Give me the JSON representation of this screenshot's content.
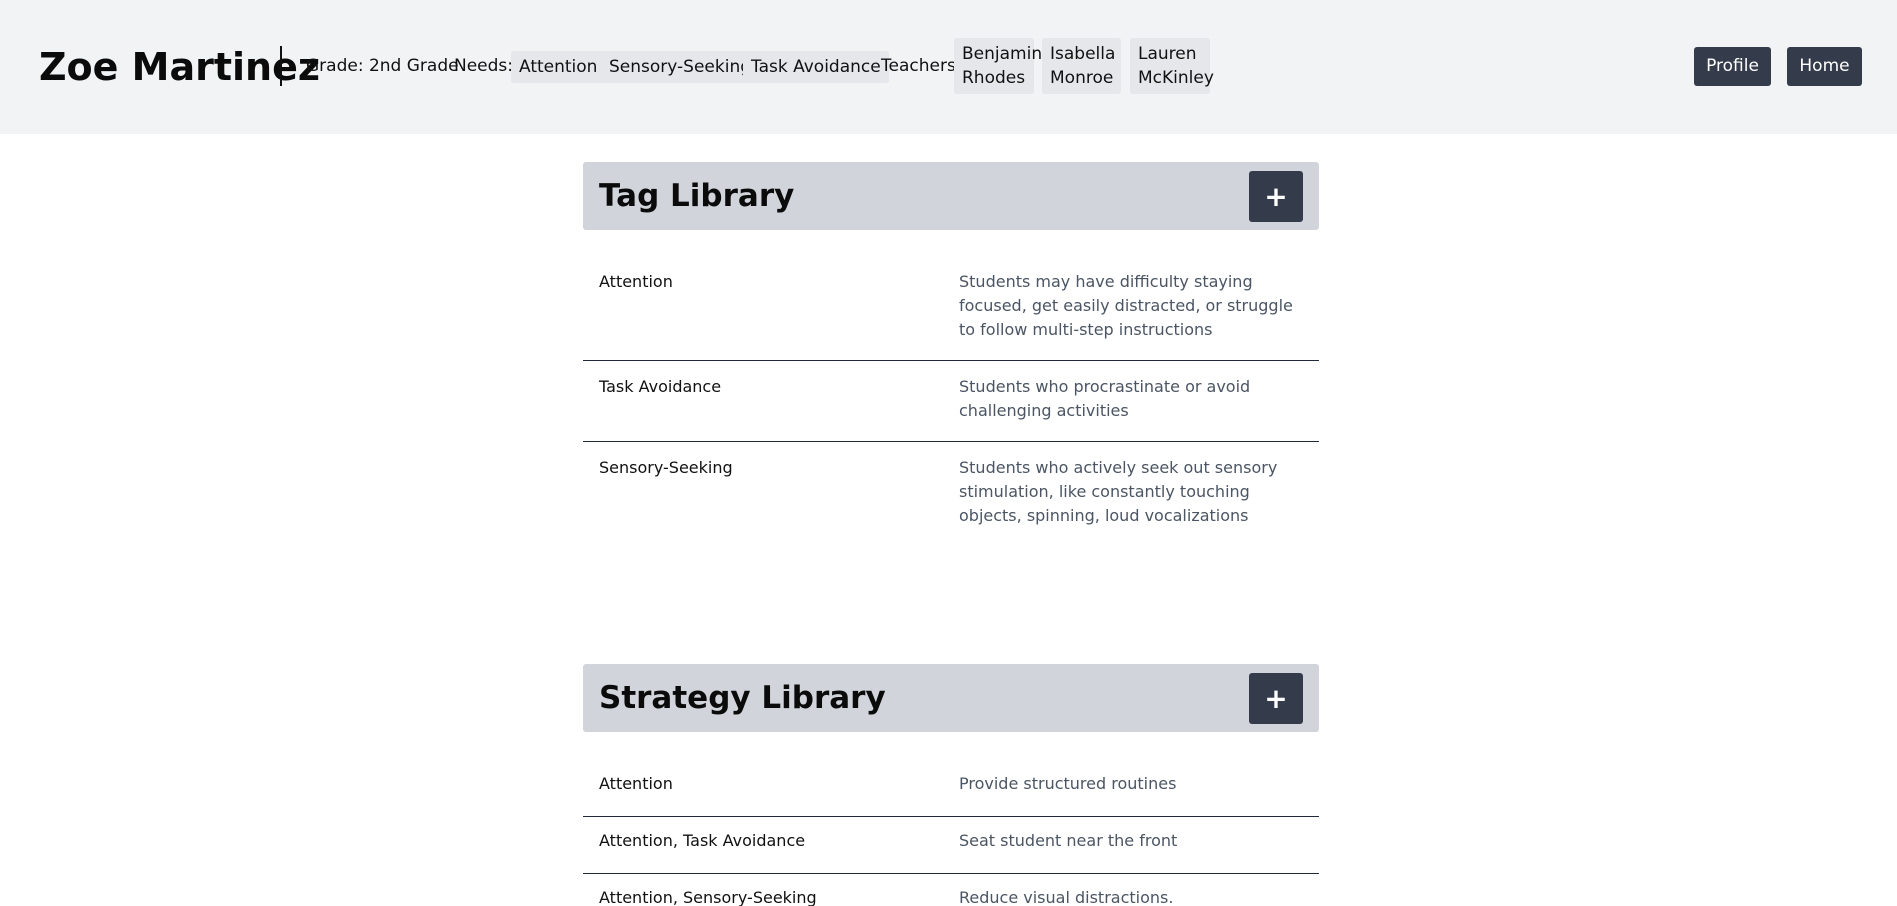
{
  "header": {
    "student_name": "Zoe Martinez",
    "grade": "Grade: 2nd Grade",
    "needs_label": "Needs:",
    "needs": [
      "Attention",
      "Sensory-Seeking",
      "Task Avoidance"
    ],
    "teachers_label": "Teachers:",
    "teachers": [
      {
        "first": "Benjamin",
        "last": "Rhodes"
      },
      {
        "first": "Isabella",
        "last": "Monroe"
      },
      {
        "first": "Lauren",
        "last": "McKinley"
      }
    ],
    "profile_button": "Profile",
    "home_button": "Home"
  },
  "tag_library": {
    "title": "Tag Library",
    "add_label": "+",
    "rows": [
      {
        "name": "Attention",
        "description": "Students may have difficulty staying focused, get easily distracted, or struggle to follow multi-step instructions"
      },
      {
        "name": "Task Avoidance",
        "description": "Students who procrastinate or avoid challenging activities"
      },
      {
        "name": "Sensory-Seeking",
        "description": "Students who actively seek out sensory stimulation, like constantly touching objects, spinning, loud vocalizations"
      }
    ]
  },
  "strategy_library": {
    "title": "Strategy Library",
    "add_label": "+",
    "rows": [
      {
        "name": "Attention",
        "description": "Provide structured routines"
      },
      {
        "name": "Attention, Task Avoidance",
        "description": "Seat student near the front"
      },
      {
        "name": "Attention, Sensory-Seeking",
        "description": "Reduce visual distractions."
      }
    ]
  },
  "colors": {
    "header_bg": "#f2f3f5",
    "button_dark": "#343b4a",
    "section_header_bg": "#d1d5db",
    "chip_bg": "#e5e7eb",
    "description_text": "#4b5563"
  },
  "icons": {
    "add": "plus-icon"
  }
}
